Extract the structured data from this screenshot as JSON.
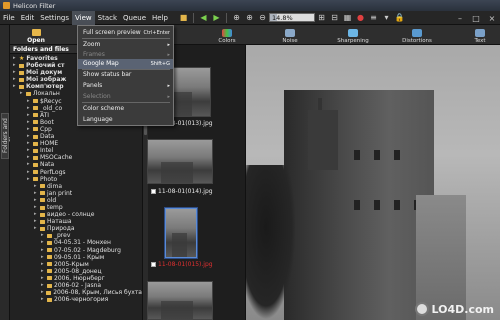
{
  "titlebar": {
    "title": "Helicon Filter"
  },
  "menu": {
    "items": [
      "File",
      "Edit",
      "Settings",
      "View",
      "Stack",
      "Queue",
      "Help"
    ]
  },
  "toolbar": {
    "zoom_value": "14.8%",
    "zoom_fill": 0.15
  },
  "tools": {
    "open_label": "Open",
    "items": [
      "Colors",
      "Noise",
      "Sharpening",
      "Distortions",
      "Text"
    ]
  },
  "sidebar": {
    "vertical_tab": "Folders and files"
  },
  "folders": {
    "title": "Folders and files",
    "items": [
      {
        "label": "Favorites",
        "kind": "star",
        "indent": 0
      },
      {
        "label": "Робочий ст",
        "kind": "folder",
        "indent": 0
      },
      {
        "label": "Мої докум",
        "kind": "folder",
        "indent": 0
      },
      {
        "label": "Мої зобрaж",
        "kind": "folder",
        "indent": 0
      },
      {
        "label": "Комп'ютер",
        "kind": "folder",
        "indent": 0
      },
      {
        "label": "Локальн",
        "kind": "folder",
        "indent": 1
      },
      {
        "label": "$Recyc",
        "kind": "folder",
        "indent": 2
      },
      {
        "label": "_old_co",
        "kind": "folder",
        "indent": 2
      },
      {
        "label": "ATI",
        "kind": "folder",
        "indent": 2
      },
      {
        "label": "Boot",
        "kind": "folder",
        "indent": 2
      },
      {
        "label": "Cpp",
        "kind": "folder",
        "indent": 2
      },
      {
        "label": "Data",
        "kind": "folder",
        "indent": 2
      },
      {
        "label": "HOME",
        "kind": "folder",
        "indent": 2
      },
      {
        "label": "Intel",
        "kind": "folder",
        "indent": 2
      },
      {
        "label": "MSOCache",
        "kind": "folder",
        "indent": 2
      },
      {
        "label": "Nata",
        "kind": "folder",
        "indent": 2
      },
      {
        "label": "PerfLogs",
        "kind": "folder",
        "indent": 2
      },
      {
        "label": "Photo",
        "kind": "folder",
        "indent": 2
      },
      {
        "label": "dima",
        "kind": "folder",
        "indent": 3
      },
      {
        "label": "jan print",
        "kind": "folder",
        "indent": 3
      },
      {
        "label": "old",
        "kind": "folder",
        "indent": 3
      },
      {
        "label": "temp",
        "kind": "folder",
        "indent": 3
      },
      {
        "label": "видео - солнце",
        "kind": "folder",
        "indent": 3
      },
      {
        "label": "Наташа",
        "kind": "folder",
        "indent": 3
      },
      {
        "label": "Природа",
        "kind": "folder",
        "indent": 3
      },
      {
        "label": "_prev",
        "kind": "folder",
        "indent": 4
      },
      {
        "label": "04-05.31 - Монхен",
        "kind": "folder",
        "indent": 4
      },
      {
        "label": "07-05.02 - Magdeburg",
        "kind": "folder",
        "indent": 4
      },
      {
        "label": "09-05.01 - Крым",
        "kind": "folder",
        "indent": 4
      },
      {
        "label": "2005-Крым",
        "kind": "folder",
        "indent": 4
      },
      {
        "label": "2005-08_донец",
        "kind": "folder",
        "indent": 4
      },
      {
        "label": "2006, Нюрнберг",
        "kind": "folder",
        "indent": 4
      },
      {
        "label": "2006-02 - Jasna",
        "kind": "folder",
        "indent": 4
      },
      {
        "label": "2006-08, Крым, Лисья бухта",
        "kind": "folder",
        "indent": 4
      },
      {
        "label": "2006-черногория",
        "kind": "folder",
        "indent": 4
      }
    ]
  },
  "thumbnails": {
    "labels": [
      "11-08-01(013).jpg",
      "11-08-01(014).jpg",
      "11-08-01(015).jpg"
    ]
  },
  "view_menu": {
    "items": [
      {
        "label": "Full screen preview",
        "shortcut": "Ctrl+Enter",
        "disabled": false
      },
      {
        "label": "Zoom",
        "shortcut": "▸",
        "disabled": false
      },
      {
        "label": "Frames",
        "shortcut": "▸",
        "disabled": true
      },
      {
        "label": "Google Map",
        "shortcut": "Shift+G",
        "disabled": false,
        "highlight": true
      },
      {
        "label": "Show status bar",
        "shortcut": "",
        "disabled": false
      },
      {
        "label": "Panels",
        "shortcut": "▸",
        "disabled": false
      },
      {
        "label": "Selection",
        "shortcut": "▸",
        "disabled": true
      },
      {
        "label": "Color scheme",
        "shortcut": "",
        "disabled": false
      },
      {
        "label": "Language",
        "shortcut": "",
        "disabled": false
      }
    ]
  },
  "watermark": {
    "text": "LO4D.com"
  }
}
